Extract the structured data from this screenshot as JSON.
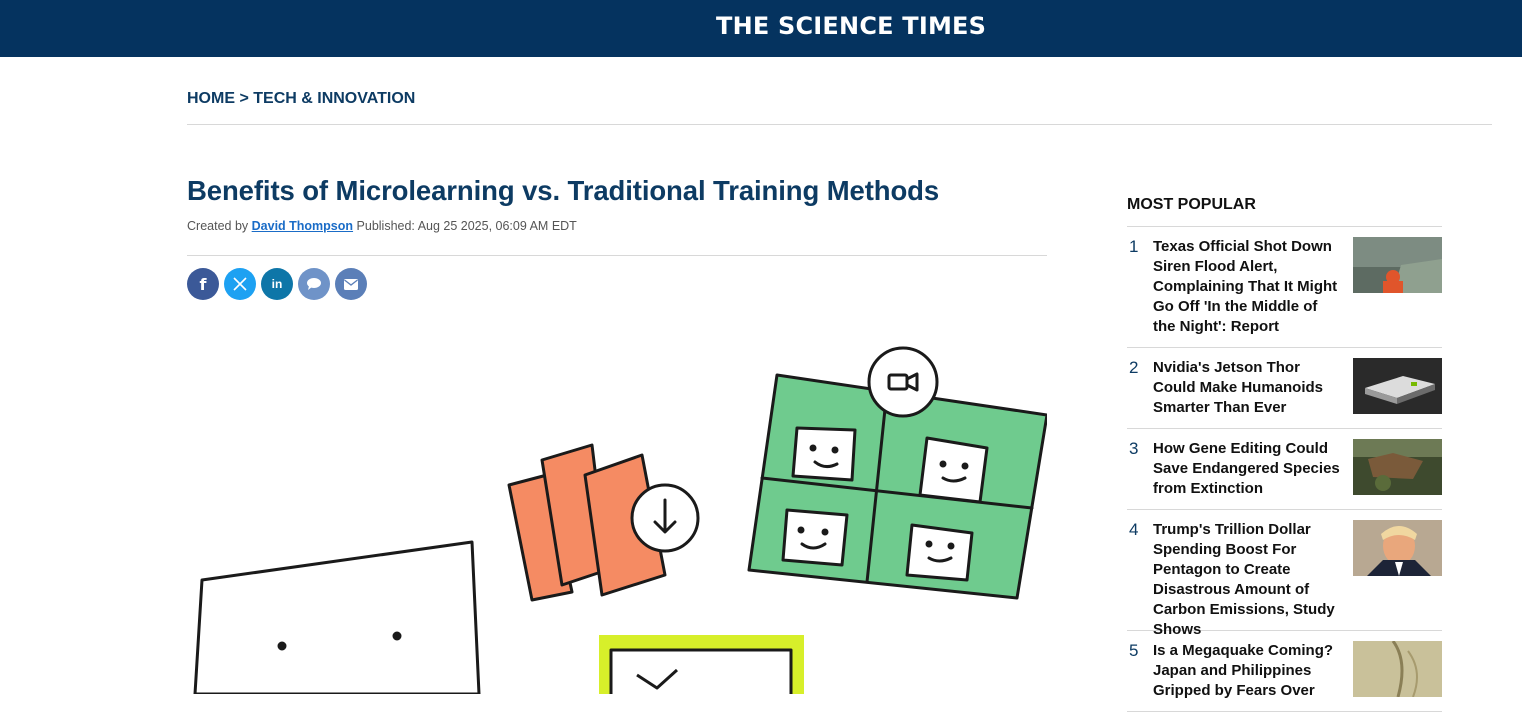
{
  "site": {
    "logo": "THE SCIENCE TIMES"
  },
  "breadcrumb": {
    "home": "HOME",
    "separator": ">",
    "section": "TECH & INNOVATION"
  },
  "article": {
    "title": "Benefits of Microlearning vs. Traditional Training Methods",
    "created_by_label": "Created by",
    "author": "David Thompson",
    "published": "Published: Aug 25 2025, 06:09 AM EDT"
  },
  "share": [
    {
      "name": "facebook",
      "glyph": "f",
      "color": "#3b5998"
    },
    {
      "name": "x",
      "glyph": "𝕏",
      "color": "#1da1f2"
    },
    {
      "name": "linkedin",
      "glyph": "in",
      "color": "#0e76a8"
    },
    {
      "name": "comment",
      "glyph": "💬",
      "color": "#6f93c8"
    },
    {
      "name": "email",
      "glyph": "✉",
      "color": "#5b7fb8"
    }
  ],
  "sidebar": {
    "title": "MOST POPULAR",
    "items": [
      {
        "num": "1",
        "text": "Texas Official Shot Down Siren Flood Alert, Complaining That It Might Go Off 'In the Middle of the Night': Report"
      },
      {
        "num": "2",
        "text": "Nvidia's Jetson Thor Could Make Humanoids Smarter Than Ever"
      },
      {
        "num": "3",
        "text": "How Gene Editing Could Save Endangered Species from Extinction"
      },
      {
        "num": "4",
        "text": "Trump's Trillion Dollar Spending Boost For Pentagon to Create Disastrous Amount of Carbon Emissions, Study Shows"
      },
      {
        "num": "5",
        "text": "Is a Megaquake Coming? Japan and Philippines Gripped by Fears Over"
      }
    ]
  },
  "colors": {
    "header": "#05335f",
    "link": "#0d3b63",
    "author": "#1a6cc7",
    "green": "#6fcb8e",
    "orange": "#f58b63",
    "lime": "#d7ef2a"
  }
}
